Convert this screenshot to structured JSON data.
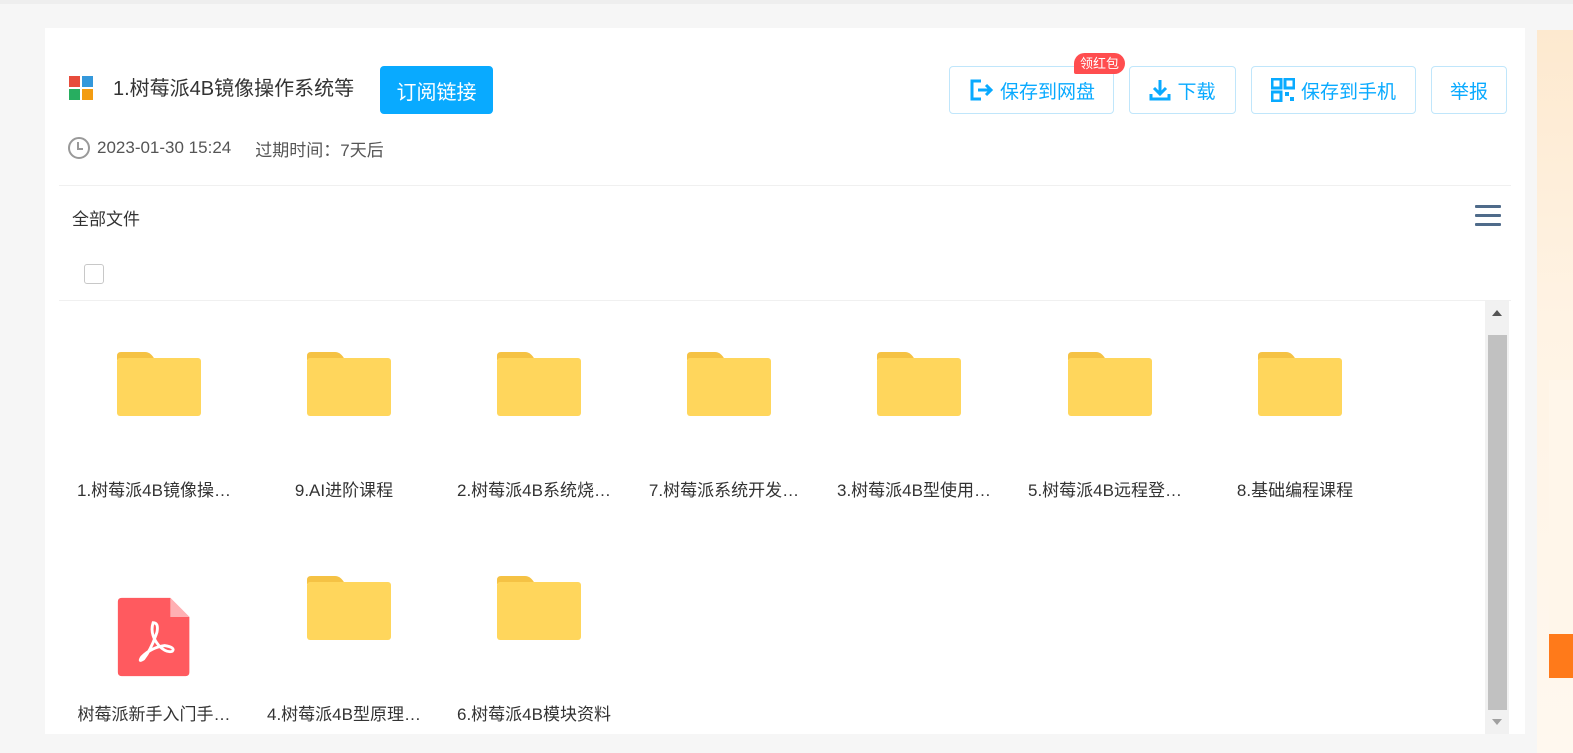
{
  "header": {
    "title": "1.树莓派4B镜像操作系统等",
    "subscribe_label": "订阅链接",
    "badge": "领红包",
    "actions": {
      "save_to_disk": "保存到网盘",
      "download": "下载",
      "save_to_phone": "保存到手机",
      "report": "举报"
    },
    "date": "2023-01-30 15:24",
    "expire": "过期时间：7天后"
  },
  "toolbar": {
    "breadcrumb": "全部文件"
  },
  "colors": {
    "accent": "#09aaff",
    "folder": "#ffd65c",
    "folder_tab": "#f5c244",
    "pdf": "#ff5a5f",
    "badge": "#ff4d4f"
  },
  "files": [
    {
      "name": "1.树莓派4B镜像操…",
      "type": "folder"
    },
    {
      "name": "9.AI进阶课程",
      "type": "folder"
    },
    {
      "name": "2.树莓派4B系统烧…",
      "type": "folder"
    },
    {
      "name": "7.树莓派系统开发…",
      "type": "folder"
    },
    {
      "name": "3.树莓派4B型使用…",
      "type": "folder"
    },
    {
      "name": "5.树莓派4B远程登…",
      "type": "folder"
    },
    {
      "name": "8.基础编程课程",
      "type": "folder"
    },
    {
      "name": "树莓派新手入门手…",
      "type": "pdf"
    },
    {
      "name": "4.树莓派4B型原理…",
      "type": "folder"
    },
    {
      "name": "6.树莓派4B模块资料",
      "type": "folder"
    }
  ]
}
